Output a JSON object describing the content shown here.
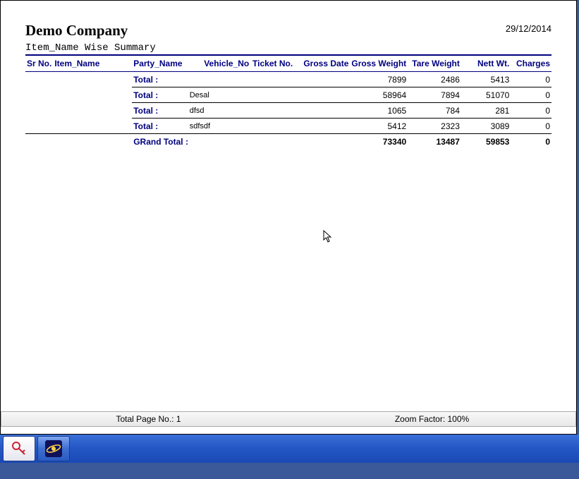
{
  "header": {
    "company": "Demo Company",
    "date": "29/12/2014",
    "subtitle": "Item_Name Wise Summary"
  },
  "columns": {
    "srno": "Sr No.",
    "item": "Item_Name",
    "party": "Party_Name",
    "vehicle": "Vehicle_No",
    "ticket": "Ticket No.",
    "gdate": "Gross Date",
    "gw": "Gross Weight",
    "tw": "Tare Weight",
    "nw": "Nett Wt.",
    "ch": "Charges"
  },
  "rows": [
    {
      "label": "Total :",
      "vehicle": "",
      "gw": "7899",
      "tw": "2486",
      "nw": "5413",
      "ch": "0"
    },
    {
      "label": "Total :",
      "vehicle": "Desal",
      "gw": "58964",
      "tw": "7894",
      "nw": "51070",
      "ch": "0"
    },
    {
      "label": "Total :",
      "vehicle": "dfsd",
      "gw": "1065",
      "tw": "784",
      "nw": "281",
      "ch": "0"
    },
    {
      "label": "Total :",
      "vehicle": "sdfsdf",
      "gw": "5412",
      "tw": "2323",
      "nw": "3089",
      "ch": "0"
    }
  ],
  "grand": {
    "label": "GRand Total :",
    "gw": "73340",
    "tw": "13487",
    "nw": "59853",
    "ch": "0"
  },
  "status": {
    "page": "Total Page No.: 1",
    "zoom": "Zoom Factor: 100%"
  }
}
